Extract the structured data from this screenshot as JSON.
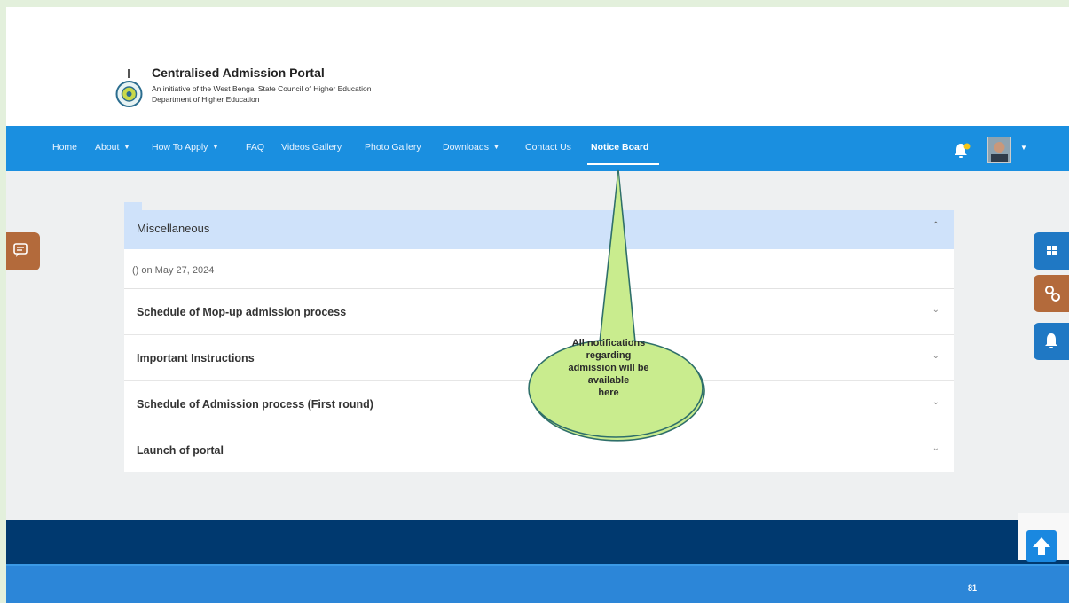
{
  "header": {
    "title": "Centralised Admission Portal",
    "subtitle_line1": "An initiative of the West Bengal State Council of Higher Education",
    "subtitle_line2": "Department of Higher Education"
  },
  "nav": {
    "items": [
      {
        "label": "Home"
      },
      {
        "label": "About"
      },
      {
        "label": "How To Apply"
      },
      {
        "label": "FAQ"
      },
      {
        "label": "Videos Gallery"
      },
      {
        "label": "Photo Gallery"
      },
      {
        "label": "Downloads"
      },
      {
        "label": "Contact Us"
      },
      {
        "label": "Notice Board"
      }
    ],
    "caret": "▼"
  },
  "notices": {
    "category": "Miscellaneous",
    "date_line": "() on May 27, 2024",
    "items": [
      {
        "title": "Schedule of Mop-up admission process"
      },
      {
        "title": "Important Instructions"
      },
      {
        "title": "Schedule of Admission process (First round)"
      },
      {
        "title": "Launch of portal"
      }
    ]
  },
  "callout": {
    "lines": [
      "All notifications",
      "regarding",
      "admission will be",
      "available",
      "here"
    ]
  },
  "footer": {
    "page_number": "81"
  },
  "icons": {
    "bell": "bell-icon",
    "feedback": "chat-icon",
    "side": [
      "grid-icon",
      "link-icon",
      "bell-icon"
    ],
    "scroll": "arrow-up-icon"
  },
  "colors": {
    "nav": "#1a8fe0",
    "accordion_header": "#cfe2fa",
    "footer_dark": "#00396f",
    "footer_light": "#2c86d8",
    "callout_fill": "#c9ec8e",
    "accent_brown": "#b36a3b",
    "side_blue": "#1f78c4"
  }
}
